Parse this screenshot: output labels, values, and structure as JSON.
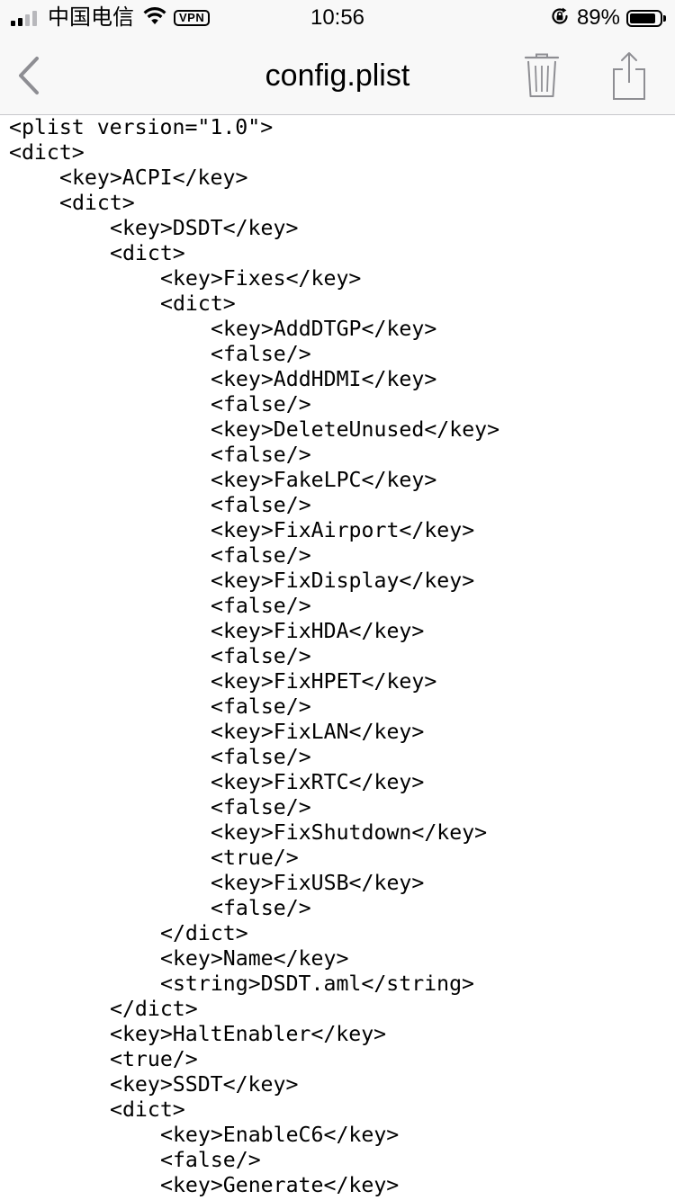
{
  "status_bar": {
    "carrier": "中国电信",
    "vpn_label": "VPN",
    "time": "10:56",
    "battery_percent": "89%",
    "battery_level": 0.89,
    "signal_bars_active": 2,
    "signal_bars_total": 4,
    "icons": [
      "signal-icon",
      "wifi-icon",
      "rotation-lock-icon",
      "battery-icon"
    ]
  },
  "nav": {
    "title": "config.plist",
    "back_icon": "chevron-left-icon",
    "trash_icon": "trash-icon",
    "share_icon": "share-icon",
    "icon_color": "#8e8e93"
  },
  "lines": [
    {
      "indent": 0,
      "text": "<plist version=\"1.0\">"
    },
    {
      "indent": 0,
      "text": "<dict>"
    },
    {
      "indent": 1,
      "text": "<key>ACPI</key>"
    },
    {
      "indent": 1,
      "text": "<dict>"
    },
    {
      "indent": 2,
      "text": "<key>DSDT</key>"
    },
    {
      "indent": 2,
      "text": "<dict>"
    },
    {
      "indent": 3,
      "text": "<key>Fixes</key>"
    },
    {
      "indent": 3,
      "text": "<dict>"
    },
    {
      "indent": 4,
      "text": "<key>AddDTGP</key>"
    },
    {
      "indent": 4,
      "text": "<false/>"
    },
    {
      "indent": 4,
      "text": "<key>AddHDMI</key>"
    },
    {
      "indent": 4,
      "text": "<false/>"
    },
    {
      "indent": 4,
      "text": "<key>DeleteUnused</key>"
    },
    {
      "indent": 4,
      "text": "<false/>"
    },
    {
      "indent": 4,
      "text": "<key>FakeLPC</key>"
    },
    {
      "indent": 4,
      "text": "<false/>"
    },
    {
      "indent": 4,
      "text": "<key>FixAirport</key>"
    },
    {
      "indent": 4,
      "text": "<false/>"
    },
    {
      "indent": 4,
      "text": "<key>FixDisplay</key>"
    },
    {
      "indent": 4,
      "text": "<false/>"
    },
    {
      "indent": 4,
      "text": "<key>FixHDA</key>"
    },
    {
      "indent": 4,
      "text": "<false/>"
    },
    {
      "indent": 4,
      "text": "<key>FixHPET</key>"
    },
    {
      "indent": 4,
      "text": "<false/>"
    },
    {
      "indent": 4,
      "text": "<key>FixLAN</key>"
    },
    {
      "indent": 4,
      "text": "<false/>"
    },
    {
      "indent": 4,
      "text": "<key>FixRTC</key>"
    },
    {
      "indent": 4,
      "text": "<false/>"
    },
    {
      "indent": 4,
      "text": "<key>FixShutdown</key>"
    },
    {
      "indent": 4,
      "text": "<true/>"
    },
    {
      "indent": 4,
      "text": "<key>FixUSB</key>"
    },
    {
      "indent": 4,
      "text": "<false/>"
    },
    {
      "indent": 3,
      "text": "</dict>"
    },
    {
      "indent": 3,
      "text": "<key>Name</key>"
    },
    {
      "indent": 3,
      "text": "<string>DSDT.aml</string>"
    },
    {
      "indent": 2,
      "text": "</dict>"
    },
    {
      "indent": 2,
      "text": "<key>HaltEnabler</key>"
    },
    {
      "indent": 2,
      "text": "<true/>"
    },
    {
      "indent": 2,
      "text": "<key>SSDT</key>"
    },
    {
      "indent": 2,
      "text": "<dict>"
    },
    {
      "indent": 3,
      "text": "<key>EnableC6</key>"
    },
    {
      "indent": 3,
      "text": "<false/>"
    },
    {
      "indent": 3,
      "text": "<key>Generate</key>"
    }
  ]
}
